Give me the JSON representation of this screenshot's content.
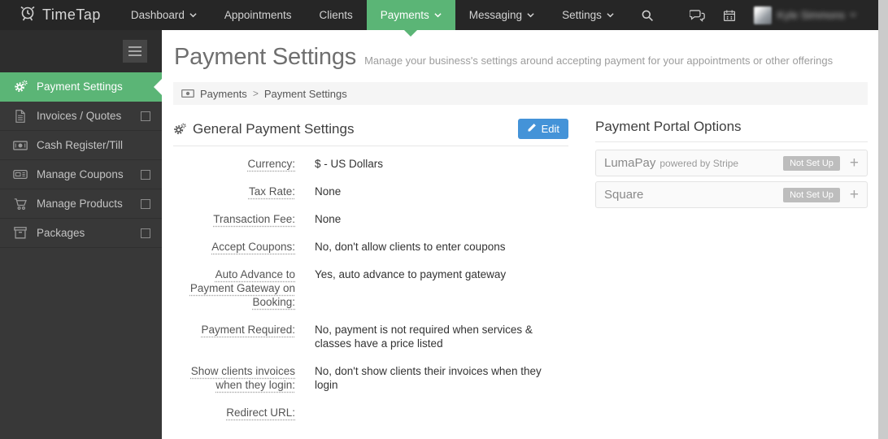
{
  "nav": {
    "brand": "TimeTap",
    "items": [
      {
        "label": "Dashboard"
      },
      {
        "label": "Appointments"
      },
      {
        "label": "Clients"
      },
      {
        "label": "Payments"
      },
      {
        "label": "Messaging"
      },
      {
        "label": "Settings"
      }
    ],
    "user_name": "Kyle Simmons"
  },
  "sidebar": {
    "items": [
      {
        "label": "Payment Settings"
      },
      {
        "label": "Invoices / Quotes"
      },
      {
        "label": "Cash Register/Till"
      },
      {
        "label": "Manage Coupons"
      },
      {
        "label": "Manage Products"
      },
      {
        "label": "Packages"
      }
    ]
  },
  "header": {
    "title": "Payment Settings",
    "subtitle": "Manage your business's settings around accepting payment for your appointments or other offerings"
  },
  "breadcrumb": {
    "items": [
      "Payments",
      "Payment Settings"
    ],
    "separator": ">"
  },
  "general": {
    "heading": "General Payment Settings",
    "edit_label": "Edit",
    "fields": [
      {
        "label": "Currency:",
        "value": "$ - US Dollars"
      },
      {
        "label": "Tax Rate:",
        "value": "None"
      },
      {
        "label": "Transaction Fee:",
        "value": "None"
      },
      {
        "label": "Accept Coupons:",
        "value": "No, don't allow clients to enter coupons"
      },
      {
        "label": "Auto Advance to Payment Gateway on Booking:",
        "value": "Yes, auto advance to payment gateway"
      },
      {
        "label": "Payment Required:",
        "value": "No, payment is not required when services & classes have a price listed"
      },
      {
        "label": "Show clients invoices when they login:",
        "value": "No, don't show clients their invoices when they login"
      },
      {
        "label": "Redirect URL:",
        "value": ""
      }
    ]
  },
  "portal": {
    "heading": "Payment Portal Options",
    "options": [
      {
        "name": "LumaPay",
        "suffix": "powered by Stripe",
        "status": "Not Set Up"
      },
      {
        "name": "Square",
        "suffix": "",
        "status": "Not Set Up"
      }
    ]
  },
  "colors": {
    "accent_green": "#5bb576",
    "edit_blue": "#4493d8",
    "badge_gray": "#bdbdbd"
  }
}
